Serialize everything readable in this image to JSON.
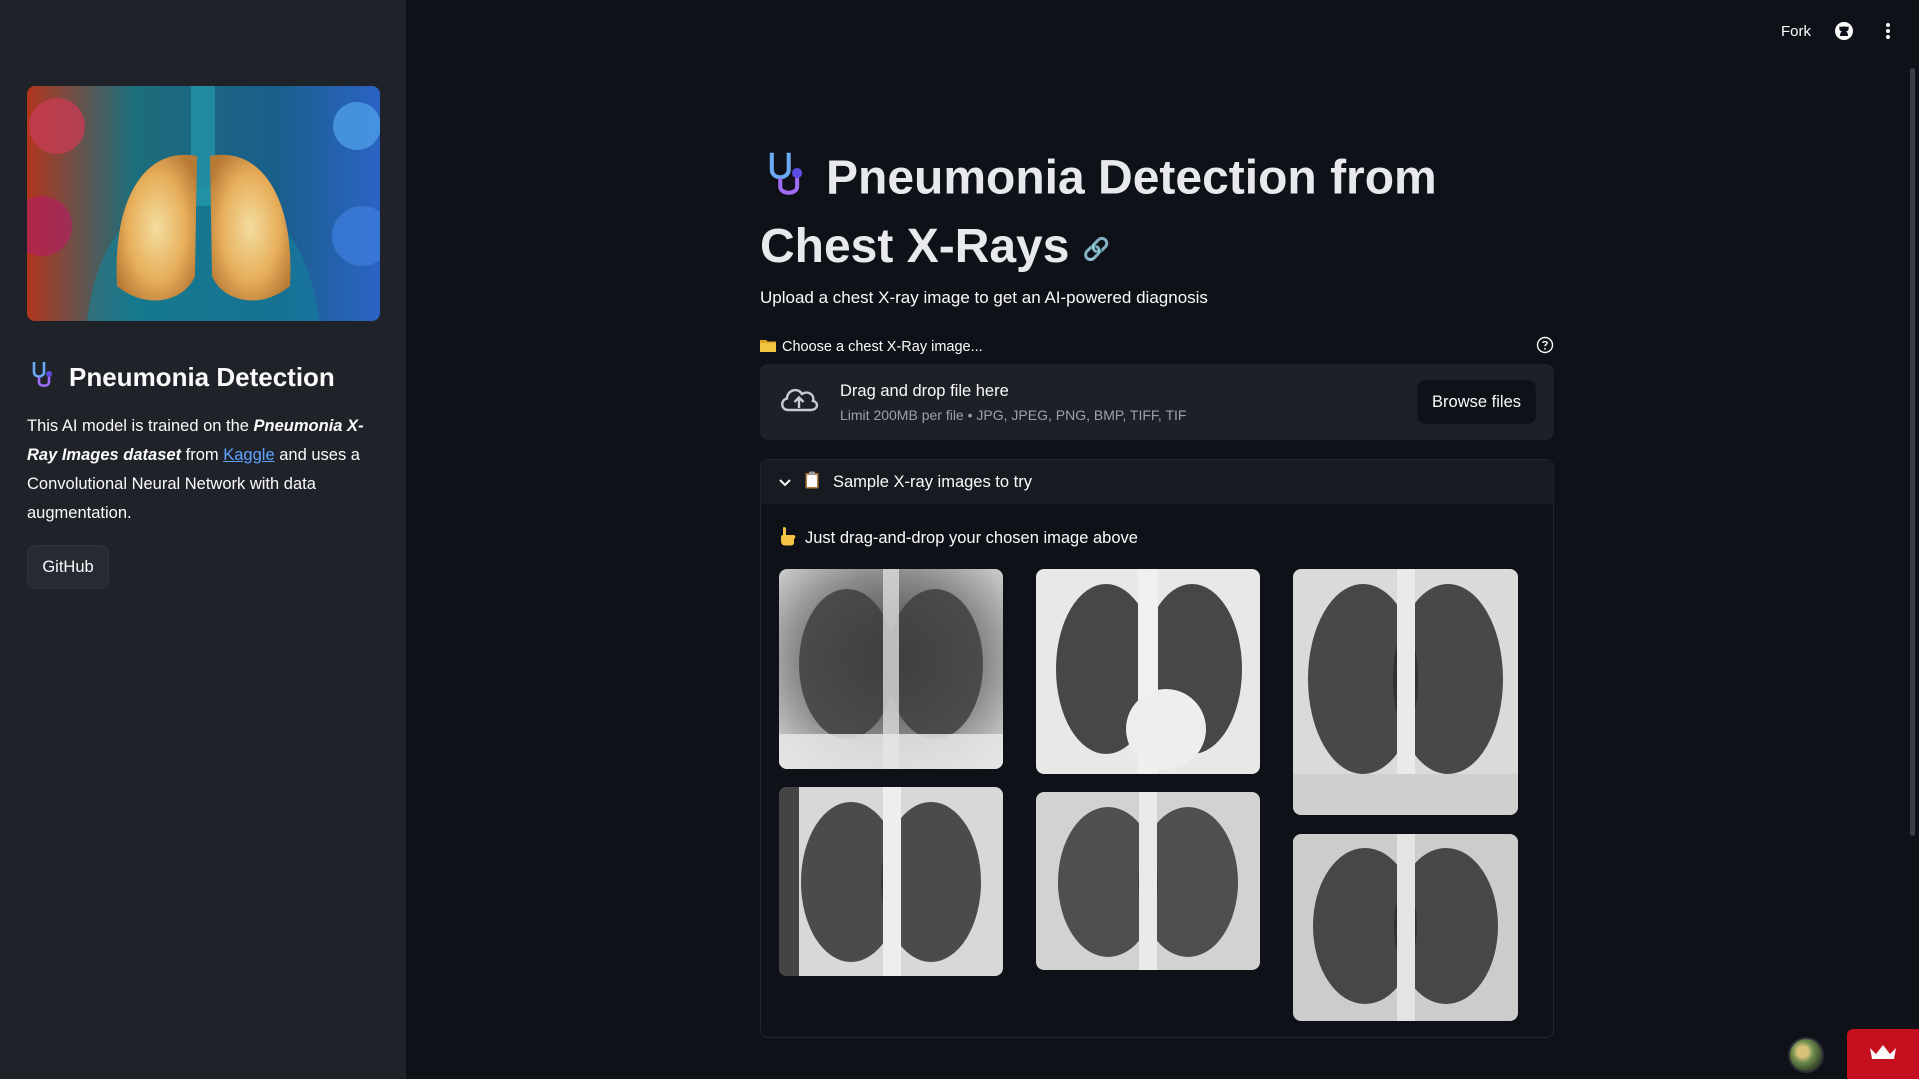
{
  "topbar": {
    "fork_label": "Fork",
    "github_icon": "github-icon",
    "menu_icon": "more-vertical-icon"
  },
  "sidebar": {
    "title": "Pneumonia Detection",
    "desc_prefix": "This AI model is trained on the ",
    "desc_dataset": "Pneumonia X-Ray Images dataset",
    "desc_from": " from ",
    "desc_link": "Kaggle",
    "desc_suffix": " and uses a Convolutional Neural Network with data augmentation.",
    "github_button": "GitHub"
  },
  "main": {
    "title_line1": "Pneumonia Detection from",
    "title_line2": "Chest X-Rays",
    "subtitle": "Upload a chest X-ray image to get an AI-powered diagnosis",
    "uploader": {
      "label": "Choose a chest X-Ray image...",
      "drop_text": "Drag and drop file here",
      "limit_text": "Limit 200MB per file • JPG, JPEG, PNG, BMP, TIFF, TIF",
      "browse_label": "Browse files"
    },
    "samples": {
      "expander_label": "Sample X-ray images to try",
      "hint": "Just drag-and-drop your chosen image above"
    }
  },
  "colors": {
    "background": "#0e1117",
    "sidebar": "#1f2228",
    "accent_link": "#5ea4ff",
    "badge_red": "#c40f1f"
  }
}
